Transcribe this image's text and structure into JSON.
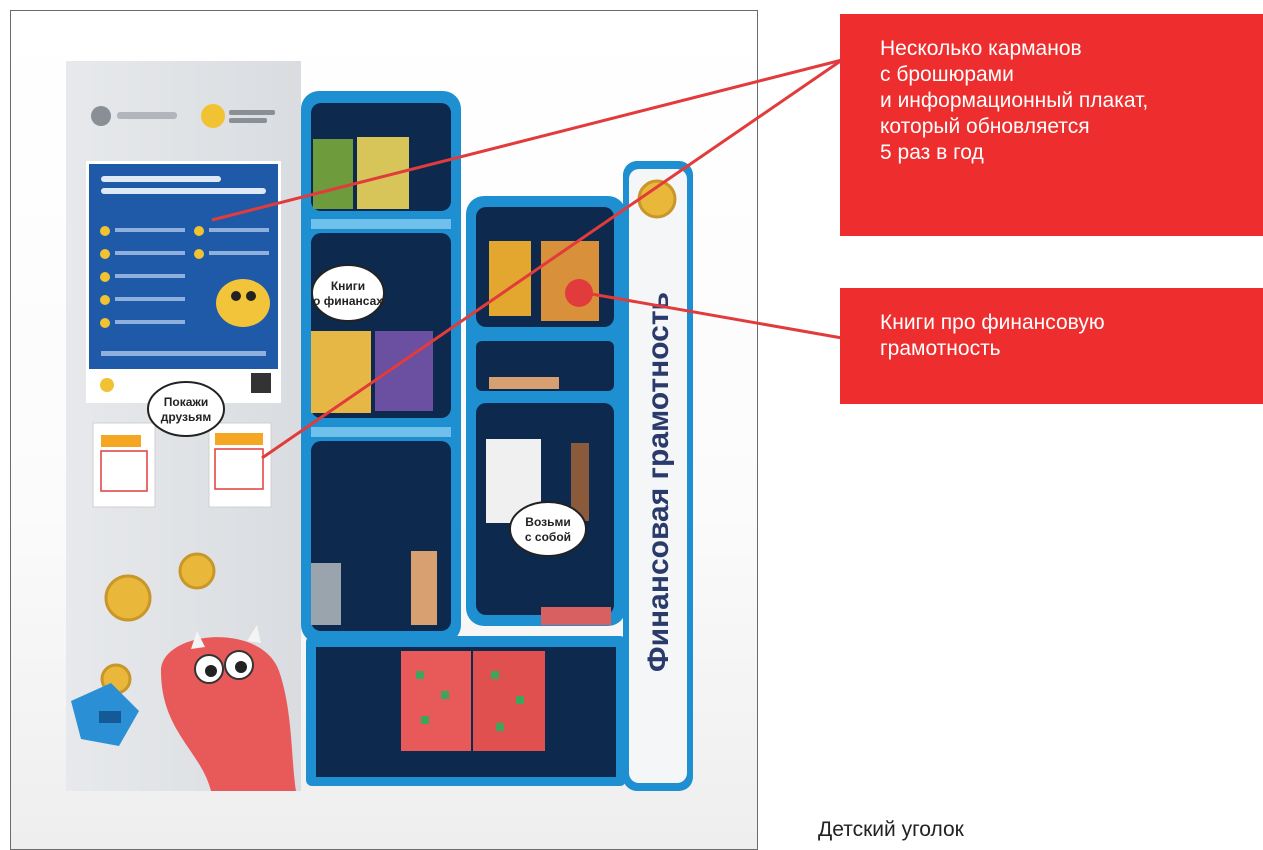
{
  "callouts": {
    "pockets": {
      "lines": [
        "Несколько карманов",
        "с брошюрами",
        "и информационный плакат,",
        "который обновляется",
        "5 раз в год"
      ]
    },
    "books": {
      "lines": [
        "Книги про финансовую",
        "грамотность"
      ]
    }
  },
  "stand": {
    "side_label": "Финансовая грамотность",
    "bubbles": {
      "books": [
        "Книги",
        "о финансах"
      ],
      "share": [
        "Покажи",
        "друзьям"
      ],
      "take": [
        "Возьми",
        "с собой"
      ]
    }
  },
  "caption": "Детский уголок",
  "colors": {
    "accent_red": "#ee2e2e",
    "shelf_blue": "#1e8fd0",
    "shelf_dark": "#0d2a4e",
    "coin_gold": "#e9b73a",
    "dino_red": "#e85a5a"
  }
}
